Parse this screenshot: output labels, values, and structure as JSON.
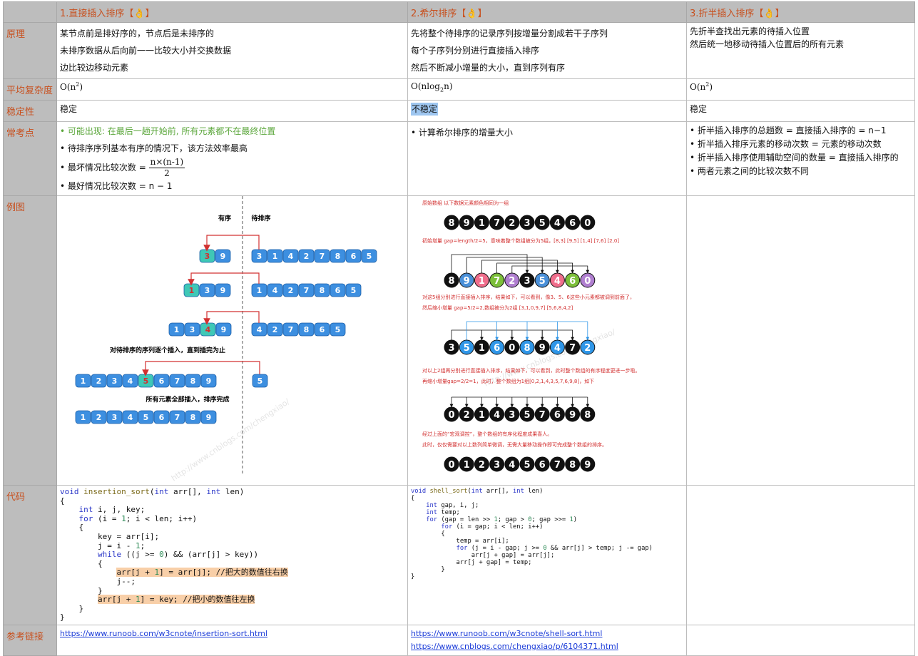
{
  "header": {
    "col1": "1.直接插入排序【👌】",
    "col2": "2.希尔排序【👌】",
    "col3": "3.折半插入排序【👌】"
  },
  "labels": {
    "principle": "原理",
    "avg": "平均复杂度",
    "stability": "稳定性",
    "common": "常考点",
    "example": "例图",
    "code": "代码",
    "refs": "参考链接"
  },
  "principle": {
    "insertion": [
      "某节点前是排好序的，节点后是未排序的",
      "未排序数据从后向前一一比较大小并交换数据",
      "边比较边移动元素"
    ],
    "shell": [
      "先将整个待排序的记录序列按增量分割成若干子序列",
      "每个子序列分别进行直接插入排序",
      "然后不断减小增量的大小，直到序列有序"
    ],
    "binary": [
      "先折半查找出元素的待插入位置",
      "然后统一地移动待插入位置后的所有元素"
    ]
  },
  "avg": {
    "insertion_base": "O(n",
    "shell_base": "O(nlog",
    "shell_sub": "2",
    "shell_tail": "n)",
    "binary_base": "O(n",
    "sup": "2",
    "close": ")"
  },
  "stability": {
    "insertion": "稳定",
    "shell": "不稳定",
    "binary": "稳定"
  },
  "common": {
    "insertion": {
      "b1": "可能出现: 在最后一趟开始前, 所有元素都不在最终位置",
      "b2": "待排序序列基本有序的情况下，该方法效率最高",
      "b3": "最坏情况比较次数 = ",
      "b3_num": "n×(n-1)",
      "b3_den": "2",
      "b4": "最好情况比较次数 = n − 1"
    },
    "shell": [
      "计算希尔排序的增量大小"
    ],
    "binary": [
      "折半插入排序的总趟数 = 直接插入排序的 = n−1",
      "折半插入排序元素的移动次数 = 元素的移动次数",
      "折半插入排序使用辅助空间的数量 = 直接插入排序的",
      "两者元素之间的比较次数不同"
    ]
  },
  "example_insertion": {
    "sorted_label": "有序",
    "unsorted_label": "待排序",
    "caption1": "对待排序的序列逐个插入，直到插完为止",
    "caption2": "所有元素全部插入，排序完成",
    "watermark": "http://www.cnblogs.com/chengxiao/",
    "rows": [
      {
        "left": [
          "3",
          "9"
        ],
        "right": [
          "3",
          "1",
          "4",
          "2",
          "7",
          "8",
          "6",
          "5"
        ]
      },
      {
        "left": [
          "1",
          "3",
          "9"
        ],
        "right": [
          "1",
          "4",
          "2",
          "7",
          "8",
          "6",
          "5"
        ]
      },
      {
        "left": [
          "1",
          "3",
          "4",
          "9"
        ],
        "right": [
          "4",
          "2",
          "7",
          "8",
          "6",
          "5"
        ]
      },
      {
        "left": [
          "1",
          "2",
          "3",
          "4",
          "5",
          "6",
          "7",
          "8",
          "9"
        ],
        "right": [
          "5"
        ]
      },
      {
        "left": [
          "1",
          "2",
          "3",
          "4",
          "5",
          "6",
          "7",
          "8",
          "9"
        ],
        "right": []
      }
    ]
  },
  "example_shell": {
    "t1": "原始数组  以下数据元素颜色相同为一组",
    "arr1": [
      "8",
      "9",
      "1",
      "7",
      "2",
      "3",
      "5",
      "4",
      "6",
      "0"
    ],
    "t2": "初始增量 gap=length/2=5，意味着整个数组被分为5组，[8,3] [9,5] [1,4] [7,6] [2,0]",
    "arr2": [
      "8",
      "9",
      "1",
      "7",
      "2",
      "3",
      "5",
      "4",
      "6",
      "0"
    ],
    "t3": "对这5组分别进行直接插入排序，结果如下，可以看到，像3、5、6这些小元素都被调到前面了，",
    "t4": "然后缩小增量 gap=5/2=2,数组被分为2组 [3,1,0,9,7] [5,6,8,4,2]",
    "arr3": [
      "3",
      "5",
      "1",
      "6",
      "0",
      "8",
      "9",
      "4",
      "7",
      "2"
    ],
    "t5": "对以上2组再分别进行直接插入排序，结果如下，可以看到，此时整个数组的有序程度更进一步啦。",
    "t6": "再缩小增量gap=2/2=1，此时，整个数组为1组[0,2,1,4,3,5,7,6,9,8]，如下",
    "arr4": [
      "0",
      "2",
      "1",
      "4",
      "3",
      "5",
      "7",
      "6",
      "9",
      "8"
    ],
    "t7": "经过上面的“宏观调控”，整个数组的有序化程度成果喜人。",
    "t8": "此时，仅仅需要对以上数列简单微调，无需大量移动操作即可完成整个数组的排序。",
    "arr5": [
      "0",
      "1",
      "2",
      "3",
      "4",
      "5",
      "6",
      "7",
      "8",
      "9"
    ],
    "watermark": "http://www.cnblogs.com/chengxiao/",
    "colors": {
      "g1": "#f06e8c",
      "g2": "#b07fd0",
      "g3": "#4a90d9",
      "g4": "#7cbf3a",
      "g5": "#8e5ec8",
      "blue": "#2f96e8"
    }
  },
  "code_insertion": [
    "void insertion_sort(int arr[], int len)",
    "{",
    "    int i, j, key;",
    "    for (i = 1; i < len; i++)",
    "    {",
    "        key = arr[i];",
    "        j = i - 1;",
    "        while ((j >= 0) && (arr[j] > key))",
    "        {",
    "            arr[j + 1] = arr[j]; //把大的数值往右换",
    "            j--;",
    "        }",
    "        arr[j + 1] = key; //把小的数值往左换",
    "    }",
    "}"
  ],
  "code_shell": [
    "void shell_sort(int arr[], int len)",
    "{",
    "    int gap, i, j;",
    "    int temp;",
    "    for (gap = len >> 1; gap > 0; gap >>= 1)",
    "        for (i = gap; i < len; i++)",
    "        {",
    "            temp = arr[i];",
    "            for (j = i - gap; j >= 0 && arr[j] > temp; j -= gap)",
    "                arr[j + gap] = arr[j];",
    "            arr[j + gap] = temp;",
    "        }",
    "}"
  ],
  "refs": {
    "insertion": "https://www.runoob.com/w3cnote/insertion-sort.html",
    "shell1": "https://www.runoob.com/w3cnote/shell-sort.html",
    "shell2": "https://www.cnblogs.com/chengxiao/p/6104371.html"
  },
  "colors": {
    "label_bg": "#bdbdbd",
    "label_text": "#c8501e",
    "box_blue": "#3d8fe0",
    "box_teal": "#3fc8b6",
    "arrow_red": "#d23030"
  }
}
